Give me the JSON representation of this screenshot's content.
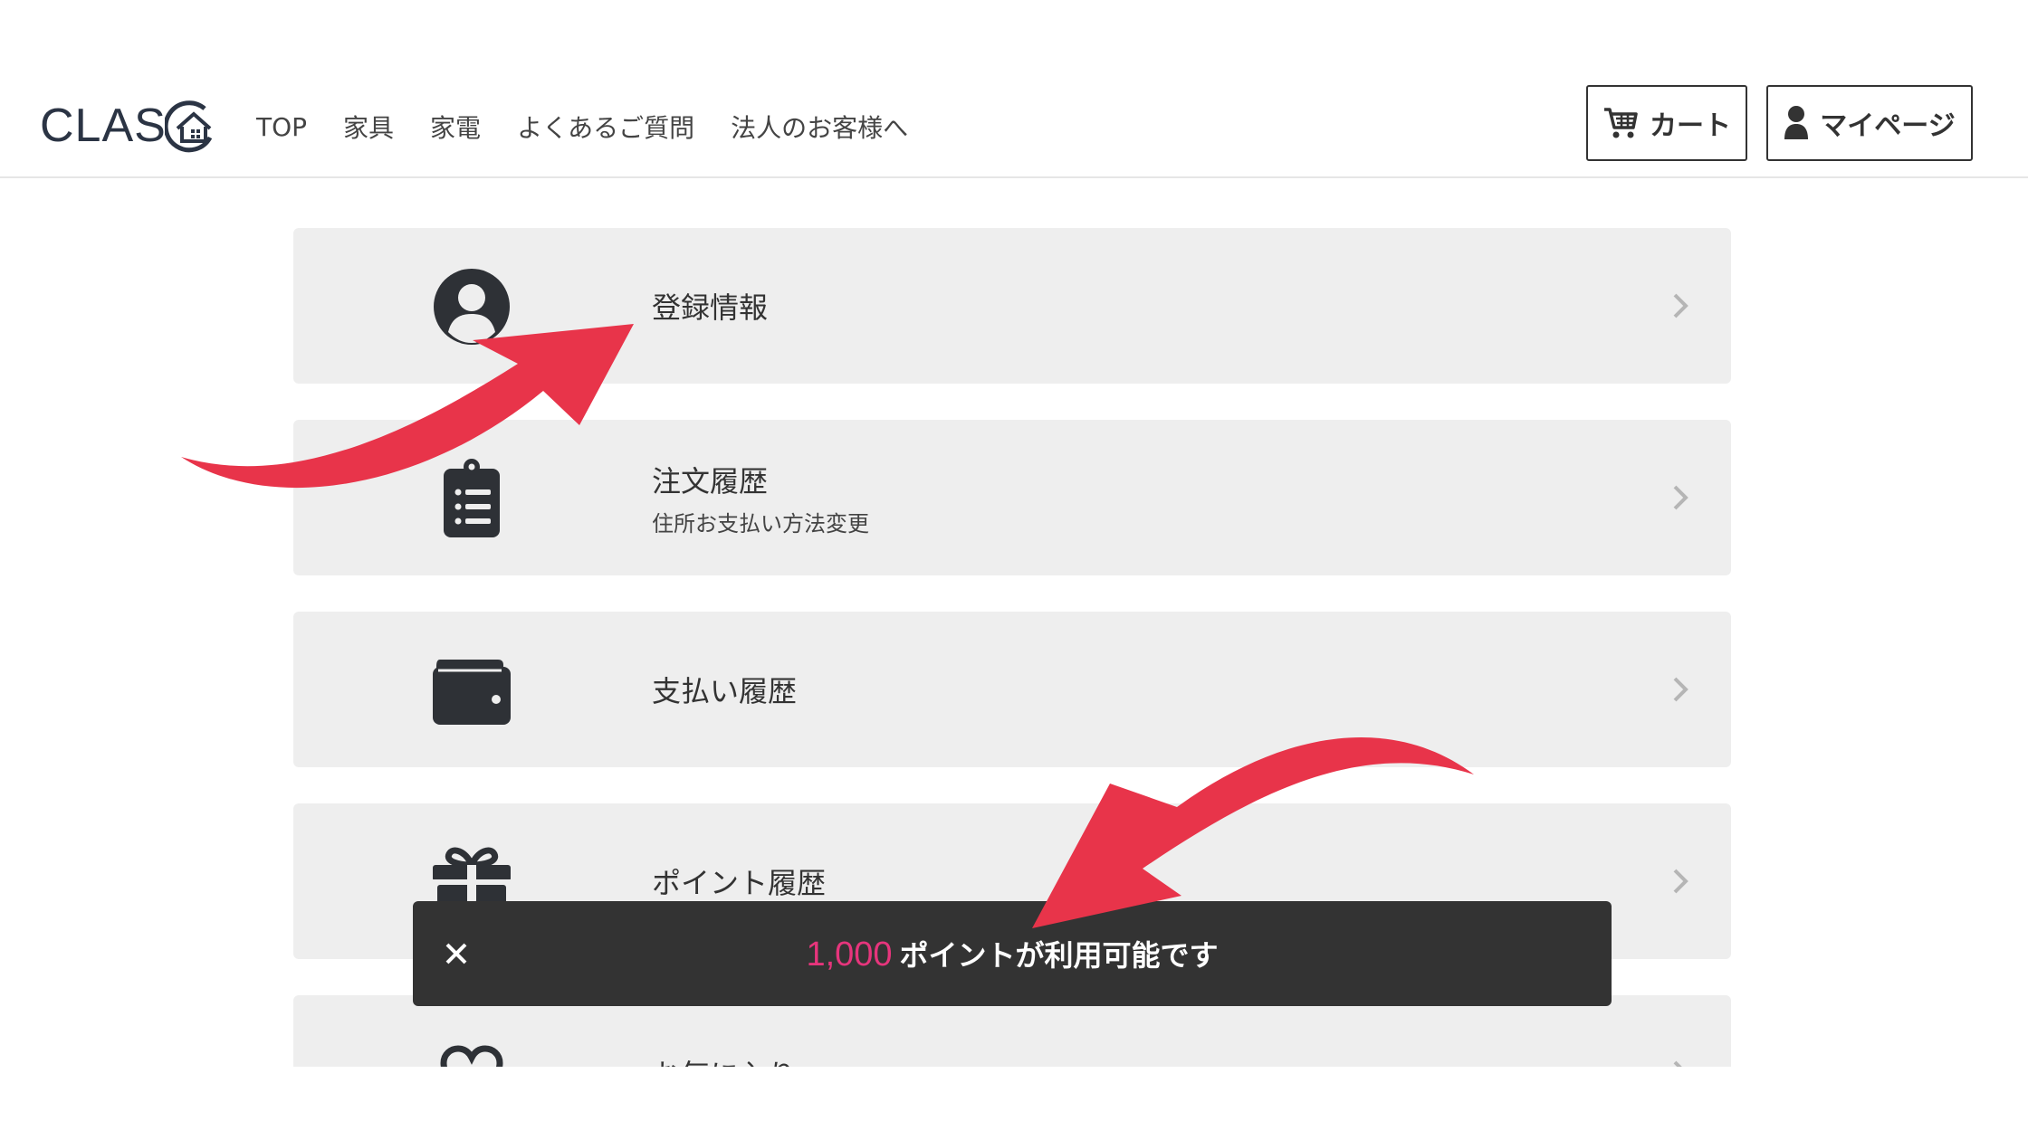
{
  "header": {
    "logo_text": "CLAS",
    "nav": [
      "TOP",
      "家具",
      "家電",
      "よくあるご質問",
      "法人のお客様へ"
    ],
    "cart_label": "カート",
    "mypage_label": "マイページ"
  },
  "menu": {
    "items": [
      {
        "title": "登録情報",
        "subtitle": "",
        "icon": "user-circle-icon"
      },
      {
        "title": "注文履歴",
        "subtitle": "住所お支払い方法変更",
        "icon": "clipboard-list-icon"
      },
      {
        "title": "支払い履歴",
        "subtitle": "",
        "icon": "wallet-icon"
      },
      {
        "title": "ポイント履歴",
        "subtitle": "",
        "icon": "gift-icon"
      },
      {
        "title": "お気に入り",
        "subtitle": "",
        "icon": "heart-icon"
      }
    ]
  },
  "toast": {
    "points": "1,000",
    "message": "ポイントが利用可能です",
    "close_icon": "close-icon"
  },
  "colors": {
    "accent_pink": "#e6357c",
    "arrow_red": "#e8344a",
    "toast_bg": "#333333",
    "card_bg": "#eeeeee"
  }
}
